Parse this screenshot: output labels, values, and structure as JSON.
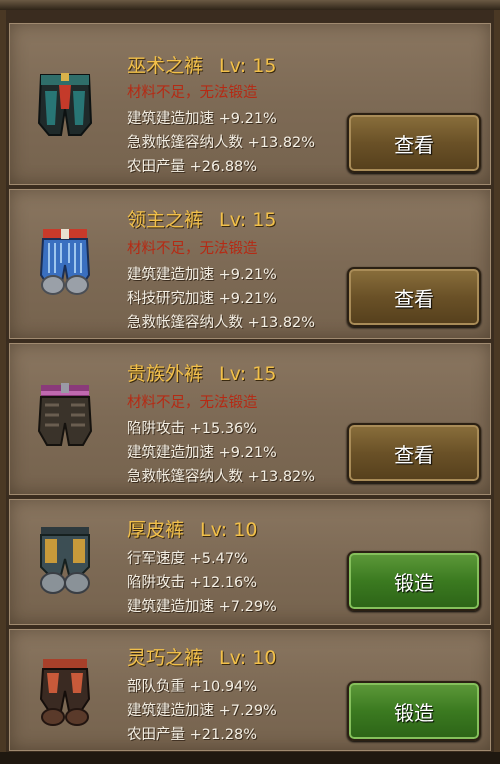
{
  "items": [
    {
      "name": "巫术之裤",
      "level": "Lv: 15",
      "warning": "材料不足，无法锻造",
      "stats": [
        "建筑建造加速 +9.21%",
        "急救帐篷容纳人数 +13.82%",
        "农田产量 +26.88%"
      ],
      "button": "查看",
      "button_type": "view",
      "icon": "witchcraft-pants-icon"
    },
    {
      "name": "领主之裤",
      "level": "Lv: 15",
      "warning": "材料不足，无法锻造",
      "stats": [
        "建筑建造加速 +9.21%",
        "科技研究加速 +9.21%",
        "急救帐篷容纳人数 +13.82%"
      ],
      "button": "查看",
      "button_type": "view",
      "icon": "lord-pants-icon"
    },
    {
      "name": "贵族外裤",
      "level": "Lv: 15",
      "warning": "材料不足，无法锻造",
      "stats": [
        "陷阱攻击 +15.36%",
        "建筑建造加速 +9.21%",
        "急救帐篷容纳人数 +13.82%"
      ],
      "button": "查看",
      "button_type": "view",
      "icon": "noble-pants-icon"
    },
    {
      "name": "厚皮裤",
      "level": "Lv: 10",
      "warning": "",
      "stats": [
        "行军速度 +5.47%",
        "陷阱攻击 +12.16%",
        "建筑建造加速 +7.29%"
      ],
      "button": "锻造",
      "button_type": "forge",
      "icon": "thick-leather-pants-icon"
    },
    {
      "name": "灵巧之裤",
      "level": "Lv: 10",
      "warning": "",
      "stats": [
        "部队负重 +10.94%",
        "建筑建造加速 +7.29%",
        "农田产量 +21.28%"
      ],
      "button": "锻造",
      "button_type": "forge",
      "icon": "agile-pants-icon"
    }
  ],
  "colors": {
    "title": "#f2c04a",
    "warning": "#b52a14",
    "stat": "#f4efe4",
    "view_button": "#6a5127",
    "forge_button": "#3b7a20"
  }
}
